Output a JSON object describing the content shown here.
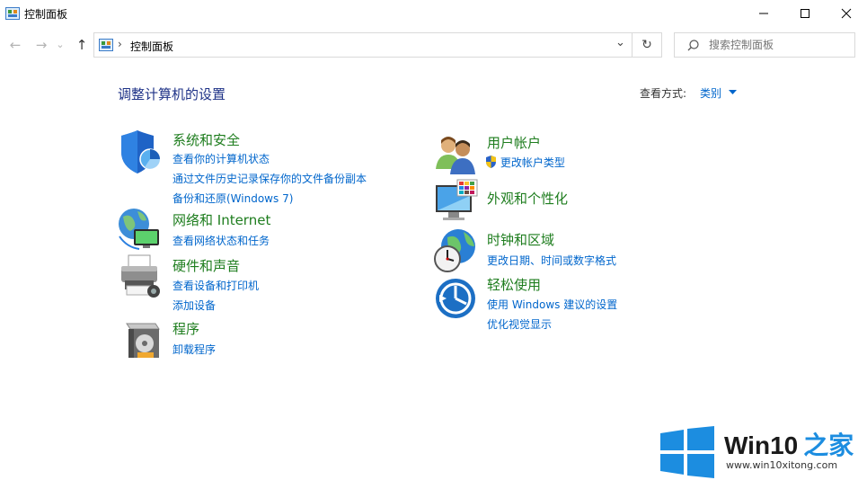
{
  "window": {
    "title": "控制面板",
    "controls": {
      "minimize": "─",
      "maximize": "☐",
      "close": "✕"
    }
  },
  "nav": {
    "back": "←",
    "forward": "→",
    "recent": "⌄",
    "up": "↑"
  },
  "address": {
    "separator": "›",
    "path": "控制面板",
    "dropdown": "⌄",
    "refresh": "↻"
  },
  "search": {
    "placeholder": "搜索控制面板"
  },
  "main": {
    "heading": "调整计算机的设置",
    "view_by_label": "查看方式:",
    "view_by_value": "类别"
  },
  "categories": {
    "system": {
      "title": "系统和安全",
      "links": [
        "查看你的计算机状态",
        "通过文件历史记录保存你的文件备份副本",
        "备份和还原(Windows 7)"
      ]
    },
    "network": {
      "title": "网络和 Internet",
      "links": [
        "查看网络状态和任务"
      ]
    },
    "hardware": {
      "title": "硬件和声音",
      "links": [
        "查看设备和打印机",
        "添加设备"
      ]
    },
    "programs": {
      "title": "程序",
      "links": [
        "卸载程序"
      ]
    },
    "users": {
      "title": "用户帐户",
      "links": [
        "更改帐户类型"
      ]
    },
    "appearance": {
      "title": "外观和个性化",
      "links": []
    },
    "clock": {
      "title": "时钟和区域",
      "links": [
        "更改日期、时间或数字格式"
      ]
    },
    "ease": {
      "title": "轻松使用",
      "links": [
        "使用 Windows 建议的设置",
        "优化视觉显示"
      ]
    }
  },
  "watermark": {
    "brand": "Win10",
    "suffix": "之家",
    "url": "www.win10xitong.com"
  },
  "colors": {
    "heading": "#1e3287",
    "category": "#1e7d1e",
    "link": "#0066cc",
    "logo": "#1c8de0"
  }
}
